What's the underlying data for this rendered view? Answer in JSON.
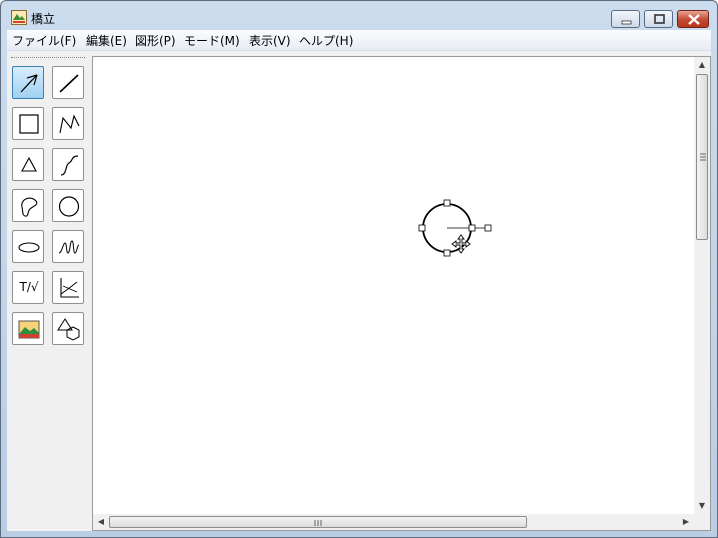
{
  "window": {
    "title": "橋立"
  },
  "menubar": {
    "items": [
      "ファイル(F)",
      "編集(E)",
      "図形(P)",
      "モード(M)",
      "表示(V)",
      "ヘルプ(H)"
    ]
  },
  "toolbox": {
    "tools": [
      {
        "name": "select-arrow",
        "active": true
      },
      {
        "name": "line"
      },
      {
        "name": "rectangle"
      },
      {
        "name": "polyline"
      },
      {
        "name": "triangle"
      },
      {
        "name": "curve"
      },
      {
        "name": "freeform-closed"
      },
      {
        "name": "circle"
      },
      {
        "name": "ellipse"
      },
      {
        "name": "spiral-curve"
      },
      {
        "name": "text-formula",
        "label": "T/√"
      },
      {
        "name": "graph"
      },
      {
        "name": "image"
      },
      {
        "name": "solid-shapes"
      }
    ]
  },
  "canvas": {
    "selected_shape": "circle"
  },
  "colors": {
    "active_tool_fill": "#9fd1f3",
    "titlebar": "#cbdcee",
    "close_button": "#c24a31"
  }
}
